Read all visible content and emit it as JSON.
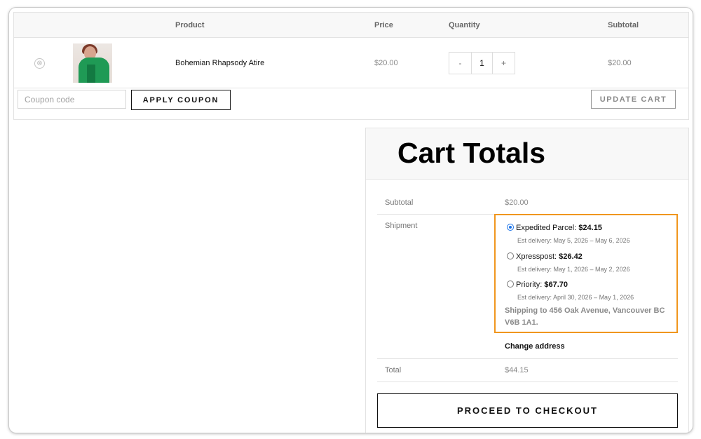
{
  "cart": {
    "headers": {
      "product": "Product",
      "price": "Price",
      "quantity": "Quantity",
      "subtotal": "Subtotal"
    },
    "items": [
      {
        "remove_icon": "⊗",
        "image_icon": "product-thumbnail",
        "name": "Bohemian Rhapsody Atire",
        "price": "$20.00",
        "qty_minus": "-",
        "qty": "1",
        "qty_plus": "+",
        "subtotal": "$20.00"
      }
    ],
    "coupon_placeholder": "Coupon code",
    "apply_coupon_label": "APPLY COUPON",
    "update_cart_label": "UPDATE CART"
  },
  "totals": {
    "title": "Cart Totals",
    "subtotal_label": "Subtotal",
    "subtotal_value": "$20.00",
    "shipment_label": "Shipment",
    "options": [
      {
        "name": "Expedited Parcel:",
        "price": "$24.15",
        "est": "Est delivery: May 5, 2026 – May 6, 2026",
        "selected": true
      },
      {
        "name": "Xpresspost:",
        "price": "$26.42",
        "est": "Est delivery: May 1, 2026 – May 2, 2026",
        "selected": false
      },
      {
        "name": "Priority:",
        "price": "$67.70",
        "est": "Est delivery: April 30, 2026 – May 1, 2026",
        "selected": false
      }
    ],
    "shipping_to": "Shipping to 456 Oak Avenue, Vancouver BC V6B 1A1.",
    "change_address": "Change address",
    "total_label": "Total",
    "total_value": "$44.15",
    "checkout_label": "PROCEED TO CHECKOUT"
  },
  "colors": {
    "highlight_border": "#f0961e",
    "radio_selected": "#1a73e8"
  }
}
